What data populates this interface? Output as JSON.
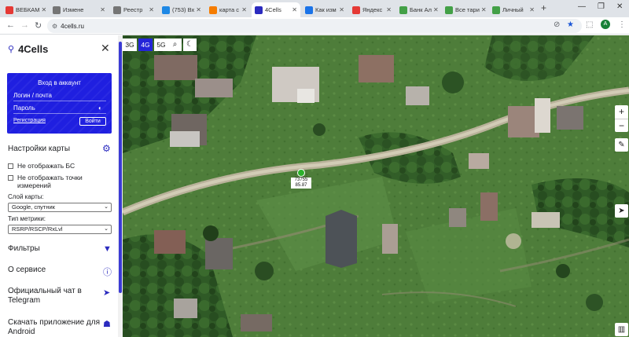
{
  "browser": {
    "tabs": [
      {
        "label": "ВЕБКАМ",
        "color": "#e53935"
      },
      {
        "label": "Измене",
        "color": "#757575"
      },
      {
        "label": "Реестр",
        "color": "#757575"
      },
      {
        "label": "(753) Вх",
        "color": "#1e88e5"
      },
      {
        "label": "карта с",
        "color": "#f57c00"
      },
      {
        "label": "4Cells",
        "color": "#2b2bbf",
        "active": true
      },
      {
        "label": "Как изм",
        "color": "#1a73e8"
      },
      {
        "label": "Яндекс",
        "color": "#e53935"
      },
      {
        "label": "Банк Ал",
        "color": "#43a047"
      },
      {
        "label": "Все тари",
        "color": "#43a047"
      },
      {
        "label": "Личный",
        "color": "#43a047"
      }
    ],
    "new_tab": "+",
    "window_controls": [
      "—",
      "❐",
      "✕"
    ],
    "url": "4cells.ru"
  },
  "sidebar": {
    "brand": "4Cells",
    "login": {
      "title": "Вход в аккаунт",
      "user_placeholder": "Логин / почта",
      "pass_placeholder": "Пароль",
      "register": "Регистрация",
      "login_button": "Войти"
    },
    "map_settings_title": "Настройки карты",
    "hide_bs": "Не отображать БС",
    "hide_measurements": "Не отображать точки измерений",
    "layer_label": "Слой карты:",
    "layer_value": "Google, спутник",
    "metric_label": "Тип метрики:",
    "metric_value": "RSRP/RSCP/RxLvl",
    "menu": {
      "filters": "Фильтры",
      "about": "О сервисе",
      "telegram": "Официальный чат в Telegram",
      "download": "Скачать приложение для Android"
    }
  },
  "map": {
    "net_buttons": [
      {
        "label": "3G",
        "active": false
      },
      {
        "label": "4G",
        "active": true
      },
      {
        "label": "5G",
        "active": false
      }
    ],
    "zoom_in": "+",
    "zoom_out": "−",
    "cell_label_line1": "73755",
    "cell_label_line2": "85.87"
  }
}
